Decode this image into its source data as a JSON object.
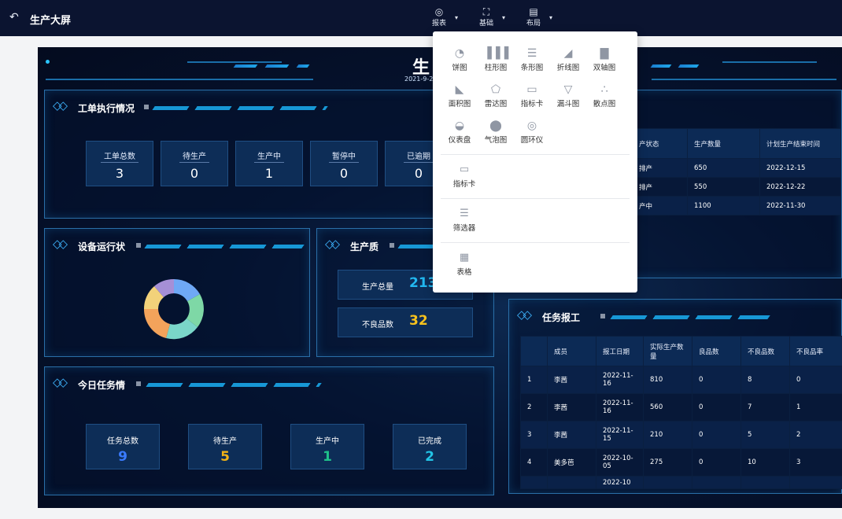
{
  "app": {
    "title": "生产大屏"
  },
  "toolbar": [
    {
      "label": "报表",
      "icon": "report-icon"
    },
    {
      "label": "基础",
      "icon": "base-icon"
    },
    {
      "label": "布局",
      "icon": "layout-icon"
    }
  ],
  "dashboard": {
    "title": "生",
    "date": "2021-9-2",
    "work_orders": {
      "title": "工单执行情况",
      "stats": [
        {
          "label": "工单总数",
          "value": "3"
        },
        {
          "label": "待生产",
          "value": "0"
        },
        {
          "label": "生产中",
          "value": "1"
        },
        {
          "label": "暂停中",
          "value": "0"
        },
        {
          "label": "已逾期",
          "value": "0"
        }
      ]
    },
    "equipment": {
      "title": "设备运行状"
    },
    "quality": {
      "title": "生产质",
      "stats": [
        {
          "label": "生产总量",
          "value": "213",
          "color": "#22b8f0"
        },
        {
          "label": "不良品数",
          "value": "32",
          "color": "#f7c21d"
        }
      ]
    },
    "today_tasks": {
      "title": "今日任务情",
      "stats": [
        {
          "label": "任务总数",
          "value": "9",
          "color": "#3a7bff"
        },
        {
          "label": "待生产",
          "value": "5",
          "color": "#f2b316"
        },
        {
          "label": "生产中",
          "value": "1",
          "color": "#1fc08a"
        },
        {
          "label": "已完成",
          "value": "2",
          "color": "#22c4e6"
        }
      ]
    },
    "plan_table": {
      "headers": [
        "产状态",
        "生产数量",
        "计划生产结束时间"
      ],
      "rows": [
        [
          "排产",
          "650",
          "2022-12-15"
        ],
        [
          "排产",
          "550",
          "2022-12-22"
        ],
        [
          "产中",
          "1100",
          "2022-11-30"
        ]
      ]
    },
    "task_report": {
      "title": "任务报工",
      "headers": [
        "",
        "成员",
        "报工日期",
        "实际生产数量",
        "良品数",
        "不良品数",
        "不良品率"
      ],
      "rows": [
        [
          "1",
          "李茜",
          "2022-11-16",
          "810",
          "0",
          "8",
          "0"
        ],
        [
          "2",
          "李茜",
          "2022-11-16",
          "560",
          "0",
          "7",
          "1"
        ],
        [
          "3",
          "李茜",
          "2022-11-15",
          "210",
          "0",
          "5",
          "2"
        ],
        [
          "4",
          "美多芭",
          "2022-10-05",
          "275",
          "0",
          "10",
          "3"
        ],
        [
          "",
          "",
          "2022-10",
          "",
          "",
          "",
          ""
        ]
      ]
    }
  },
  "menu": {
    "charts": [
      {
        "label": "饼图",
        "icon": "pie-chart-icon"
      },
      {
        "label": "柱形图",
        "icon": "bar-chart-icon"
      },
      {
        "label": "条形图",
        "icon": "hbar-chart-icon"
      },
      {
        "label": "折线图",
        "icon": "line-chart-icon"
      },
      {
        "label": "双轴图",
        "icon": "dual-axis-chart-icon"
      },
      {
        "label": "面积图",
        "icon": "area-chart-icon"
      },
      {
        "label": "雷达图",
        "icon": "radar-chart-icon"
      },
      {
        "label": "指标卡",
        "icon": "indicator-card-icon"
      },
      {
        "label": "漏斗图",
        "icon": "funnel-chart-icon"
      },
      {
        "label": "散点图",
        "icon": "scatter-chart-icon"
      },
      {
        "label": "仪表盘",
        "icon": "gauge-icon"
      },
      {
        "label": "气泡图",
        "icon": "bubble-chart-icon"
      },
      {
        "label": "圆环仪",
        "icon": "ring-gauge-icon"
      }
    ],
    "others": [
      {
        "label": "指标卡",
        "icon": "indicator-card-icon"
      },
      {
        "label": "筛选器",
        "icon": "filter-icon"
      },
      {
        "label": "表格",
        "icon": "table-icon"
      }
    ]
  }
}
